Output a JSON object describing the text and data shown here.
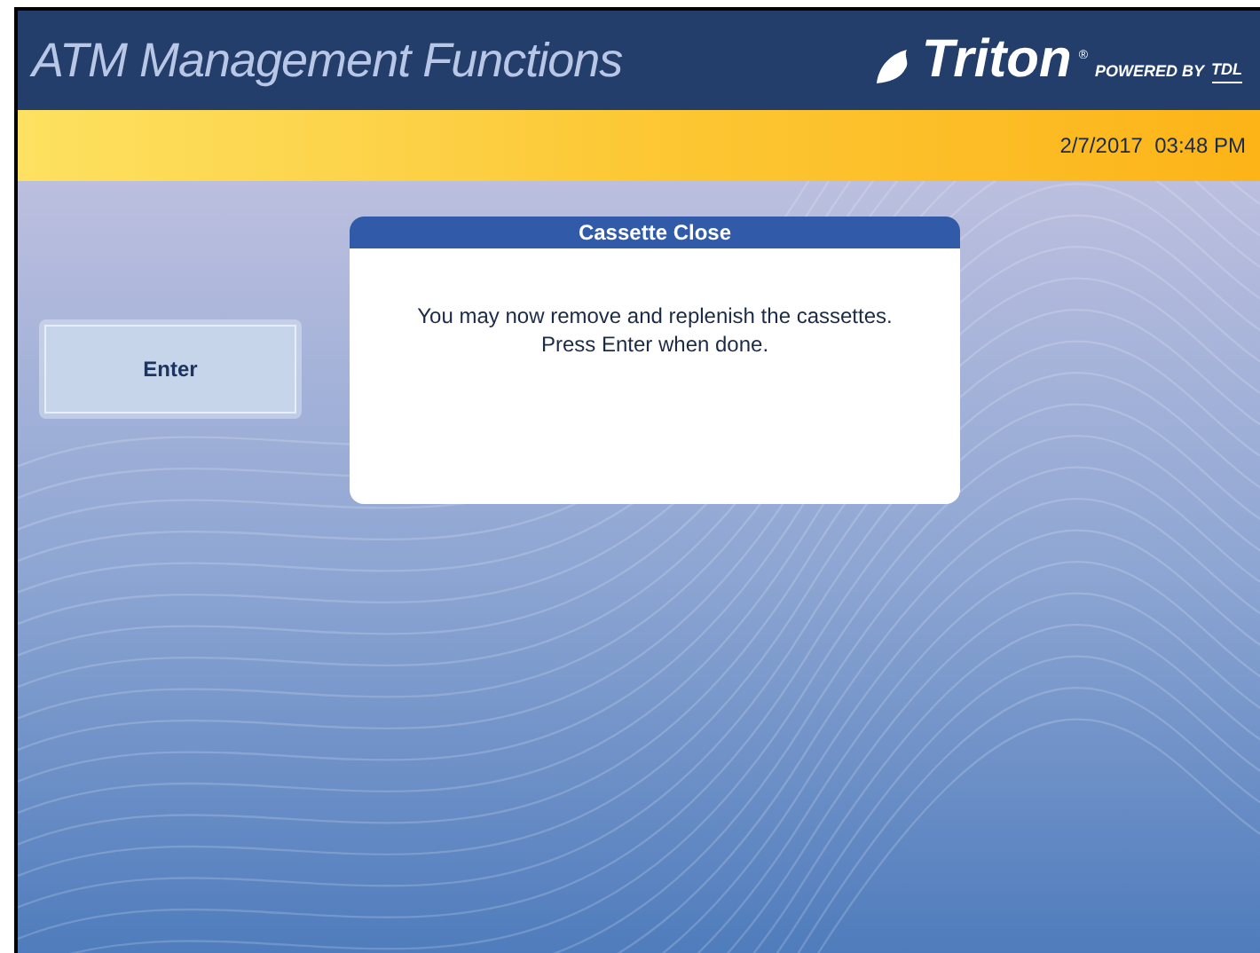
{
  "header": {
    "title": "ATM Management Functions",
    "logo": {
      "name": "Triton",
      "mark": "®",
      "tagline": "POWERED BY",
      "brand": "TDL"
    }
  },
  "status_bar": {
    "datetime": "2/7/2017  03:48 PM"
  },
  "buttons": [
    {
      "label": "Enter"
    }
  ],
  "dialog": {
    "title": "Cassette Close",
    "message": "You may now remove and replenish the cassettes.\nPress Enter when done."
  }
}
